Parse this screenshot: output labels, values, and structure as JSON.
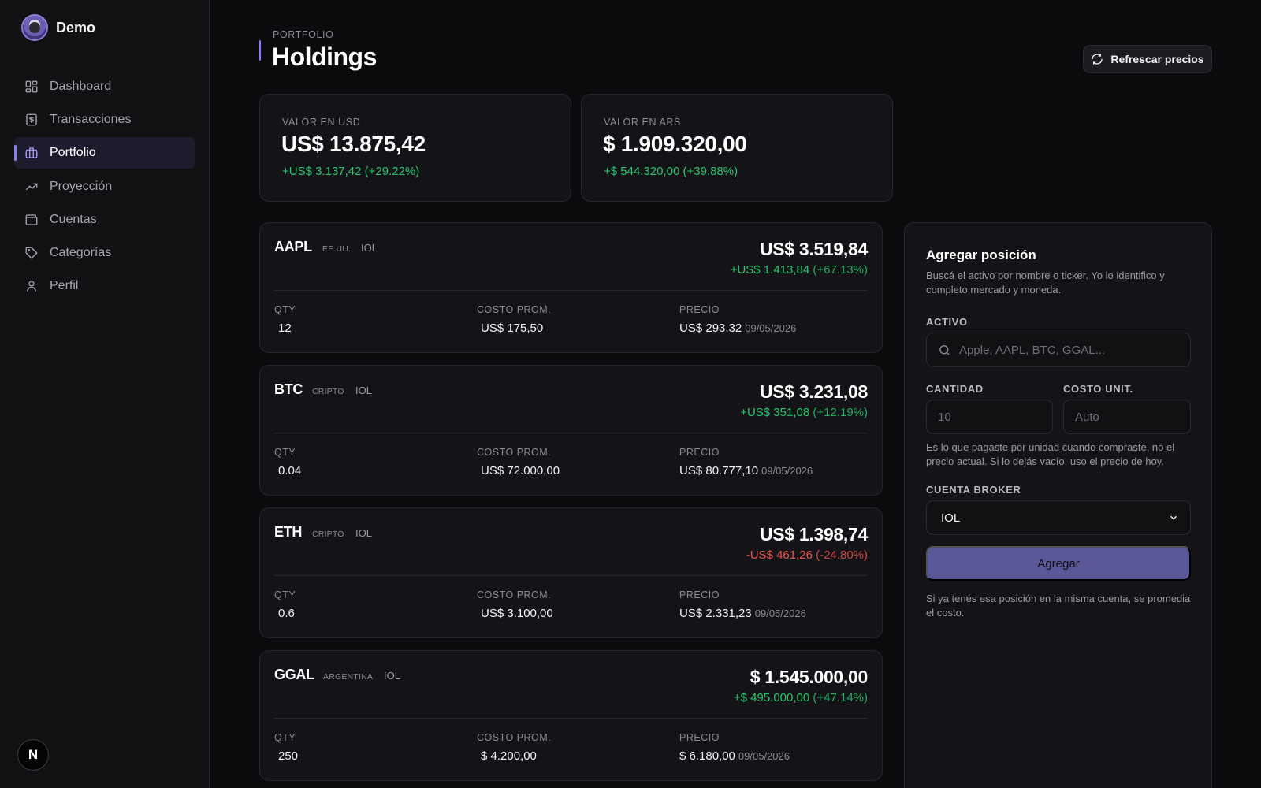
{
  "app": {
    "name": "Demo"
  },
  "sidebar": {
    "items": [
      {
        "label": "Dashboard",
        "icon": "dashboard-icon"
      },
      {
        "label": "Transacciones",
        "icon": "receipt-icon"
      },
      {
        "label": "Portfolio",
        "icon": "briefcase-icon",
        "active": true
      },
      {
        "label": "Proyección",
        "icon": "trending-up-icon"
      },
      {
        "label": "Cuentas",
        "icon": "wallet-icon"
      },
      {
        "label": "Categorías",
        "icon": "tag-icon"
      },
      {
        "label": "Perfil",
        "icon": "user-icon"
      }
    ],
    "footer_badge": "N"
  },
  "header": {
    "eyebrow": "PORTFOLIO",
    "title": "Holdings",
    "refresh_label": "Refrescar precios"
  },
  "summary": [
    {
      "label": "VALOR EN USD",
      "value": "US$ 13.875,42",
      "change": "+US$ 3.137,42 (+29.22%)"
    },
    {
      "label": "VALOR EN ARS",
      "value": "$ 1.909.320,00",
      "change": "+$ 544.320,00 (+39.88%)"
    }
  ],
  "holdings": [
    {
      "ticker": "AAPL",
      "market": "EE.UU.",
      "broker": "IOL",
      "total": "US$ 3.519,84",
      "change_amount": "+US$ 1.413,84",
      "change_pct": "(+67.13%)",
      "direction": "pos",
      "qty_label": "QTY",
      "qty": "12",
      "cost_label": "COSTO PROM.",
      "cost": "US$ 175,50",
      "price_label": "PRECIO",
      "price": "US$ 293,32",
      "date": "09/05/2026"
    },
    {
      "ticker": "BTC",
      "market": "CRIPTO",
      "broker": "IOL",
      "total": "US$ 3.231,08",
      "change_amount": "+US$ 351,08",
      "change_pct": "(+12.19%)",
      "direction": "pos",
      "qty_label": "QTY",
      "qty": "0.04",
      "cost_label": "COSTO PROM.",
      "cost": "US$ 72.000,00",
      "price_label": "PRECIO",
      "price": "US$ 80.777,10",
      "date": "09/05/2026"
    },
    {
      "ticker": "ETH",
      "market": "CRIPTO",
      "broker": "IOL",
      "total": "US$ 1.398,74",
      "change_amount": "-US$ 461,26",
      "change_pct": "(-24.80%)",
      "direction": "neg",
      "qty_label": "QTY",
      "qty": "0.6",
      "cost_label": "COSTO PROM.",
      "cost": "US$ 3.100,00",
      "price_label": "PRECIO",
      "price": "US$ 2.331,23",
      "date": "09/05/2026"
    },
    {
      "ticker": "GGAL",
      "market": "ARGENTINA",
      "broker": "IOL",
      "total": "$ 1.545.000,00",
      "change_amount": "+$ 495.000,00",
      "change_pct": "(+47.14%)",
      "direction": "pos",
      "qty_label": "QTY",
      "qty": "250",
      "cost_label": "COSTO PROM.",
      "cost": "$ 4.200,00",
      "price_label": "PRECIO",
      "price": "$ 6.180,00",
      "date": "09/05/2026"
    }
  ],
  "add_form": {
    "title": "Agregar posición",
    "description": "Buscá el activo por nombre o ticker. Yo lo identifico y completo mercado y moneda.",
    "asset_label": "ACTIVO",
    "asset_placeholder": "Apple, AAPL, BTC, GGAL...",
    "qty_label": "CANTIDAD",
    "qty_placeholder": "10",
    "cost_label": "COSTO UNIT.",
    "cost_placeholder": "Auto",
    "cost_hint": "Es lo que pagaste por unidad cuando compraste, no el precio actual. Si lo dejás vacío, uso el precio de hoy.",
    "broker_label": "CUENTA BROKER",
    "broker_value": "IOL",
    "submit_label": "Agregar",
    "footer_note": "Si ya tenés esa posición en la misma cuenta, se promedia el costo."
  },
  "colors": {
    "accent": "#8b7ff0",
    "positive": "#27c46b",
    "negative": "#f0544f",
    "button": "#5b589a"
  }
}
